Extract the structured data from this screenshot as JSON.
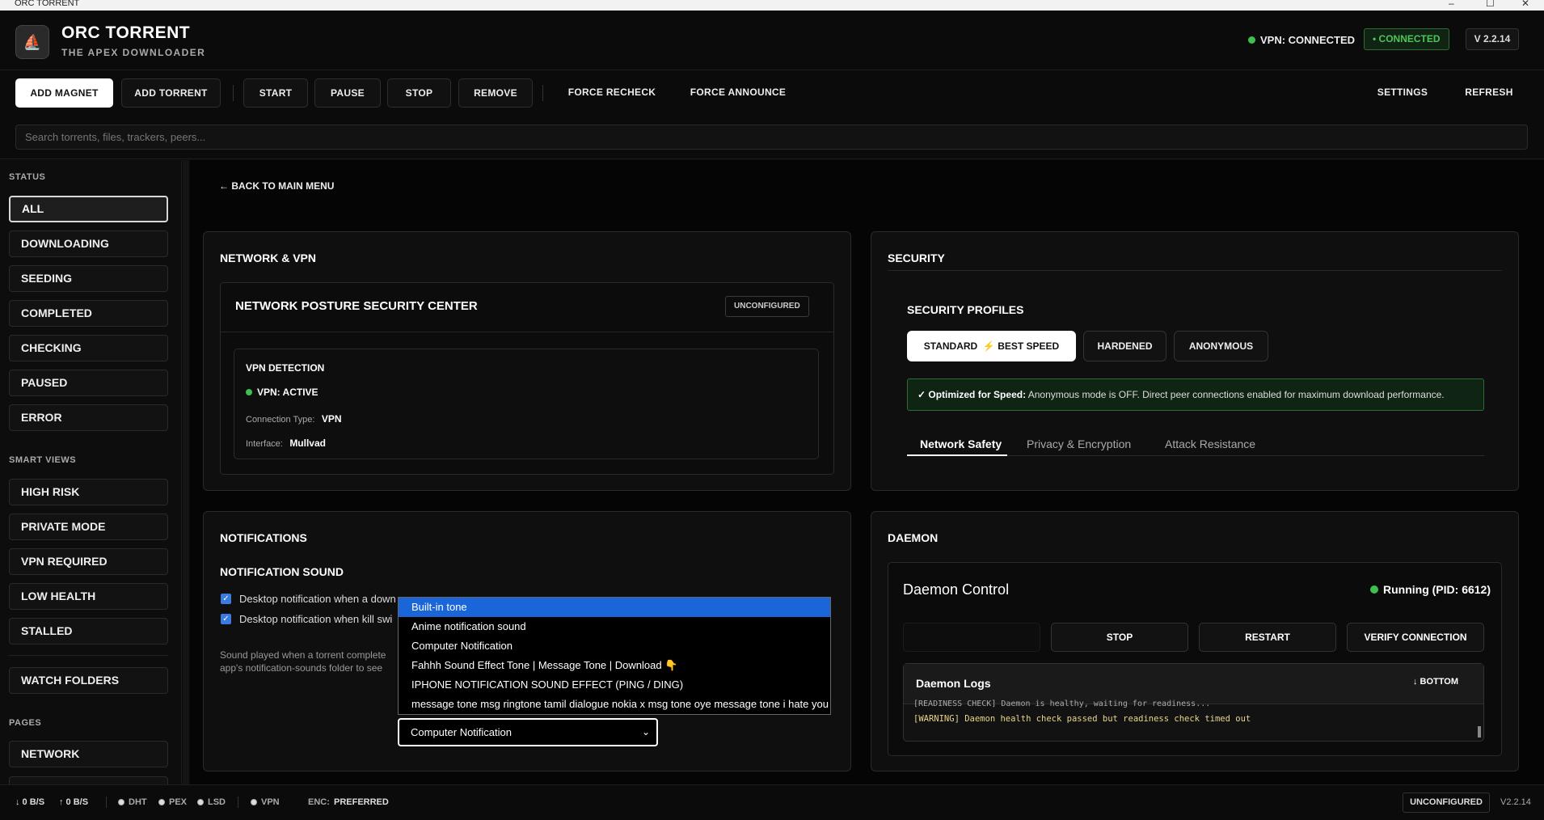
{
  "window": {
    "title": "ORC TORRENT",
    "min": "–",
    "max": "☐",
    "close": "✕"
  },
  "header": {
    "logo_icon": "orc-logo",
    "app_name": "ORC TORRENT",
    "tagline": "THE APEX DOWNLOADER",
    "vpn_status": "VPN: CONNECTED",
    "connection_badge": "• CONNECTED",
    "version": "V  2.2.14",
    "status_color": "#3fbf4f"
  },
  "toolbar": {
    "add_magnet": "ADD MAGNET",
    "add_torrent": "ADD TORRENT",
    "start": "START",
    "pause": "PAUSE",
    "stop": "STOP",
    "remove": "REMOVE",
    "force_recheck": "FORCE RECHECK",
    "force_announce": "FORCE ANNOUNCE",
    "settings": "SETTINGS",
    "refresh": "REFRESH"
  },
  "search": {
    "placeholder": "Search torrents, files, trackers, peers..."
  },
  "sidebar": {
    "status_heading": "STATUS",
    "status_items": [
      "ALL",
      "DOWNLOADING",
      "SEEDING",
      "COMPLETED",
      "CHECKING",
      "PAUSED",
      "ERROR"
    ],
    "smart_heading": "SMART VIEWS",
    "smart_items": [
      "HIGH RISK",
      "PRIVATE MODE",
      "VPN REQUIRED",
      "LOW HEALTH",
      "STALLED"
    ],
    "watch_folders": "WATCH FOLDERS",
    "pages_heading": "PAGES",
    "pages_items": [
      "NETWORK"
    ]
  },
  "main": {
    "back_link": "← BACK TO MAIN MENU"
  },
  "network": {
    "title": "NETWORK & VPN",
    "posture_title": "NETWORK POSTURE SECURITY CENTER",
    "posture_badge": "UNCONFIGURED",
    "vpn_detection_title": "VPN DETECTION",
    "vpn_active": "VPN: ACTIVE",
    "connection_type_label": "Connection Type:",
    "connection_type_value": "VPN",
    "interface_label": "Interface:",
    "interface_value": "Mullvad"
  },
  "security": {
    "title": "SECURITY",
    "profiles_title": "SECURITY PROFILES",
    "profile_standard": "STANDARD",
    "profile_standard_extra": "BEST SPEED",
    "profile_hardened": "HARDENED",
    "profile_anonymous": "ANONYMOUS",
    "notice_bold": "✓ Optimized for Speed:",
    "notice_text": " Anonymous mode is OFF. Direct peer connections enabled for maximum download performance.",
    "tabs": [
      "Network Safety",
      "Privacy & Encryption",
      "Attack Resistance"
    ]
  },
  "notifications": {
    "title": "NOTIFICATIONS",
    "sound_title": "NOTIFICATION SOUND",
    "check1": "Desktop notification when a down",
    "check2": "Desktop notification when kill swi",
    "desc1": "Sound played when a torrent complete",
    "desc2": "app's notification-sounds folder to see",
    "sound_options": [
      "Built-in tone",
      "Anime notification sound",
      "Computer Notification",
      "Fahhh Sound Effect Tone  |  Message Tone  |  Download 👇",
      "IPHONE NOTIFICATION SOUND EFFECT (PING / DING)",
      "message tone msg ringtone tamil dialogue nokia x msg tone oye message tone i hate you"
    ],
    "selected_sound": "Computer Notification"
  },
  "daemon": {
    "title": "DAEMON",
    "control_title": "Daemon Control",
    "running_status": "Running (PID: 6612)",
    "stop": "STOP",
    "restart": "RESTART",
    "verify": "VERIFY CONNECTION",
    "logs_title": "Daemon Logs",
    "logs_bottom": "↓ BOTTOM",
    "log_line_1": "[READINESS CHECK] Daemon is healthy, waiting for readiness...",
    "log_line_2": "[WARNING] Daemon health check passed but readiness check timed out"
  },
  "statusbar": {
    "down": "↓ 0 B/S",
    "up": "↑ 0 B/S",
    "dht": "DHT",
    "pex": "PEX",
    "lsd": "LSD",
    "vpn": "VPN",
    "enc_label": "ENC:",
    "enc_value": "PREFERRED",
    "badge": "UNCONFIGURED",
    "version": "V2.2.14"
  }
}
